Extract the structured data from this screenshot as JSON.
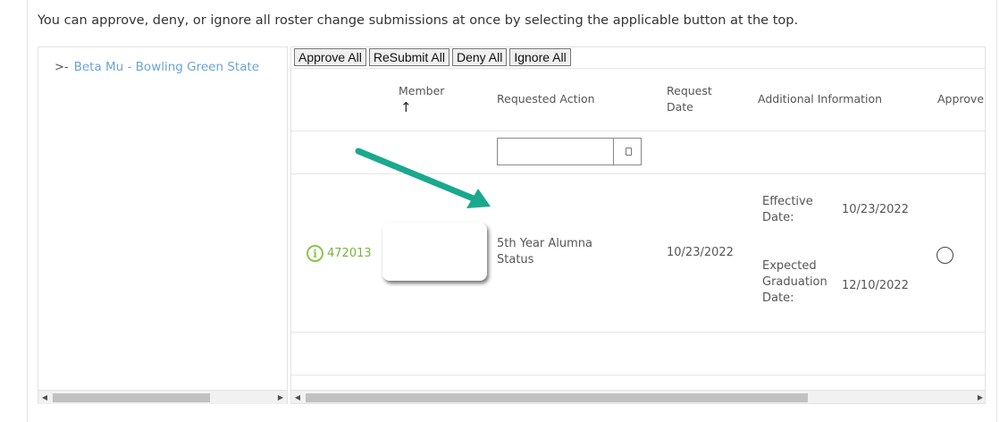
{
  "intro_text": "You can approve, deny, or ignore all roster change submissions at once by selecting the applicable button at the top.",
  "tree": {
    "items": [
      {
        "label": "Beta Mu - Bowling Green State"
      }
    ]
  },
  "toolbar": {
    "approve_all": "Approve All",
    "resubmit_all": "ReSubmit All",
    "deny_all": "Deny All",
    "ignore_all": "Ignore All"
  },
  "columns": {
    "member": "Member",
    "member_sort": "↑",
    "requested_action": "Requested Action",
    "request_date_1": "Request",
    "request_date_2": "Date",
    "additional_information": "Additional Information",
    "approve": "Approve"
  },
  "rows": [
    {
      "member_id": "472013",
      "requested_action_1": "5th Year Alumna",
      "requested_action_2": "Status",
      "request_date": "10/23/2022",
      "effective_label_1": "Effective",
      "effective_label_2": "Date:",
      "effective_value": "10/23/2022",
      "expected_label_1": "Expected",
      "expected_label_2": "Graduation",
      "expected_label_3": "Date:",
      "expected_value": "12/10/2022"
    }
  ],
  "colors": {
    "accent_link": "#6aa3d8",
    "member_green": "#7bb13c",
    "annotation_arrow": "#1aa88f"
  },
  "icons": {
    "tree_expand": "chevron-right-icon",
    "info": "info-circle-icon",
    "filter": "calendar-icon"
  }
}
